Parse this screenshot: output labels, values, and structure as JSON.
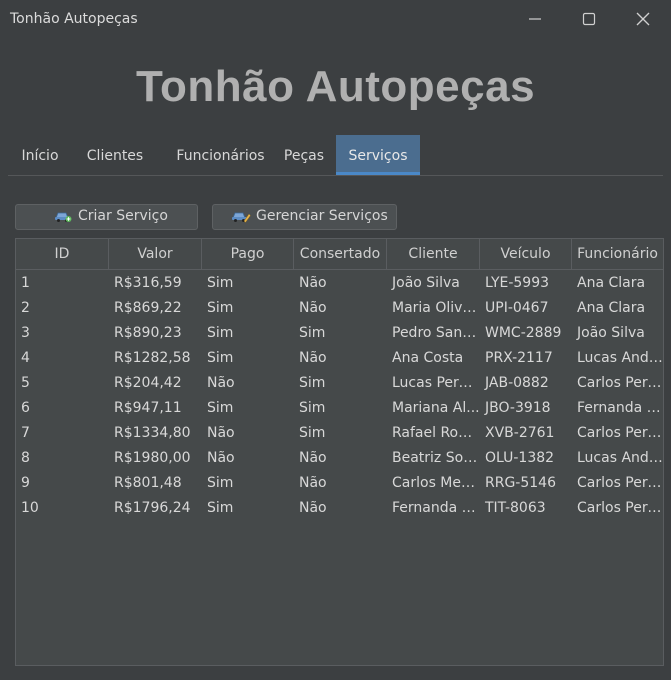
{
  "window": {
    "title": "Tonhão Autopeças"
  },
  "app": {
    "heading": "Tonhão Autopeças"
  },
  "tabs": [
    {
      "label": "Início",
      "active": false
    },
    {
      "label": "Clientes",
      "active": false
    },
    {
      "label": "Funcionários",
      "active": false
    },
    {
      "label": "Peças",
      "active": false
    },
    {
      "label": "Serviços",
      "active": true
    }
  ],
  "toolbar": {
    "create_label": "Criar Serviço",
    "create_icon": "car-add-icon",
    "manage_label": "Gerenciar Serviços",
    "manage_icon": "car-edit-icon"
  },
  "table": {
    "columns": [
      "ID",
      "Valor",
      "Pago",
      "Consertado",
      "Cliente",
      "Veículo",
      "Funcionário"
    ],
    "rows": [
      [
        "1",
        "R$316,59",
        "Sim",
        "Não",
        "João Silva",
        "LYE-5993",
        "Ana Clara"
      ],
      [
        "2",
        "R$869,22",
        "Sim",
        "Não",
        "Maria Olive...",
        "UPI-0467",
        "Ana Clara"
      ],
      [
        "3",
        "R$890,23",
        "Sim",
        "Sim",
        "Pedro Sant...",
        "WMC-2889",
        "João Silva"
      ],
      [
        "4",
        "R$1282,58",
        "Sim",
        "Não",
        "Ana Costa",
        "PRX-2117",
        "Lucas Andr..."
      ],
      [
        "5",
        "R$204,42",
        "Não",
        "Sim",
        "Lucas Pereir...",
        "JAB-0882",
        "Carlos Perei..."
      ],
      [
        "6",
        "R$947,11",
        "Sim",
        "Sim",
        "Mariana Al...",
        "JBO-3918",
        "Fernanda S..."
      ],
      [
        "7",
        "R$1334,80",
        "Não",
        "Sim",
        "Rafael Rodr...",
        "XVB-2761",
        "Carlos Perei..."
      ],
      [
        "8",
        "R$1980,00",
        "Não",
        "Não",
        "Beatriz Sou...",
        "OLU-1382",
        "Lucas Andr..."
      ],
      [
        "9",
        "R$801,48",
        "Sim",
        "Não",
        "Carlos Men...",
        "RRG-5146",
        "Carlos Perei..."
      ],
      [
        "10",
        "R$1796,24",
        "Sim",
        "Não",
        "Fernanda L...",
        "TIT-8063",
        "Carlos Perei..."
      ]
    ]
  }
}
